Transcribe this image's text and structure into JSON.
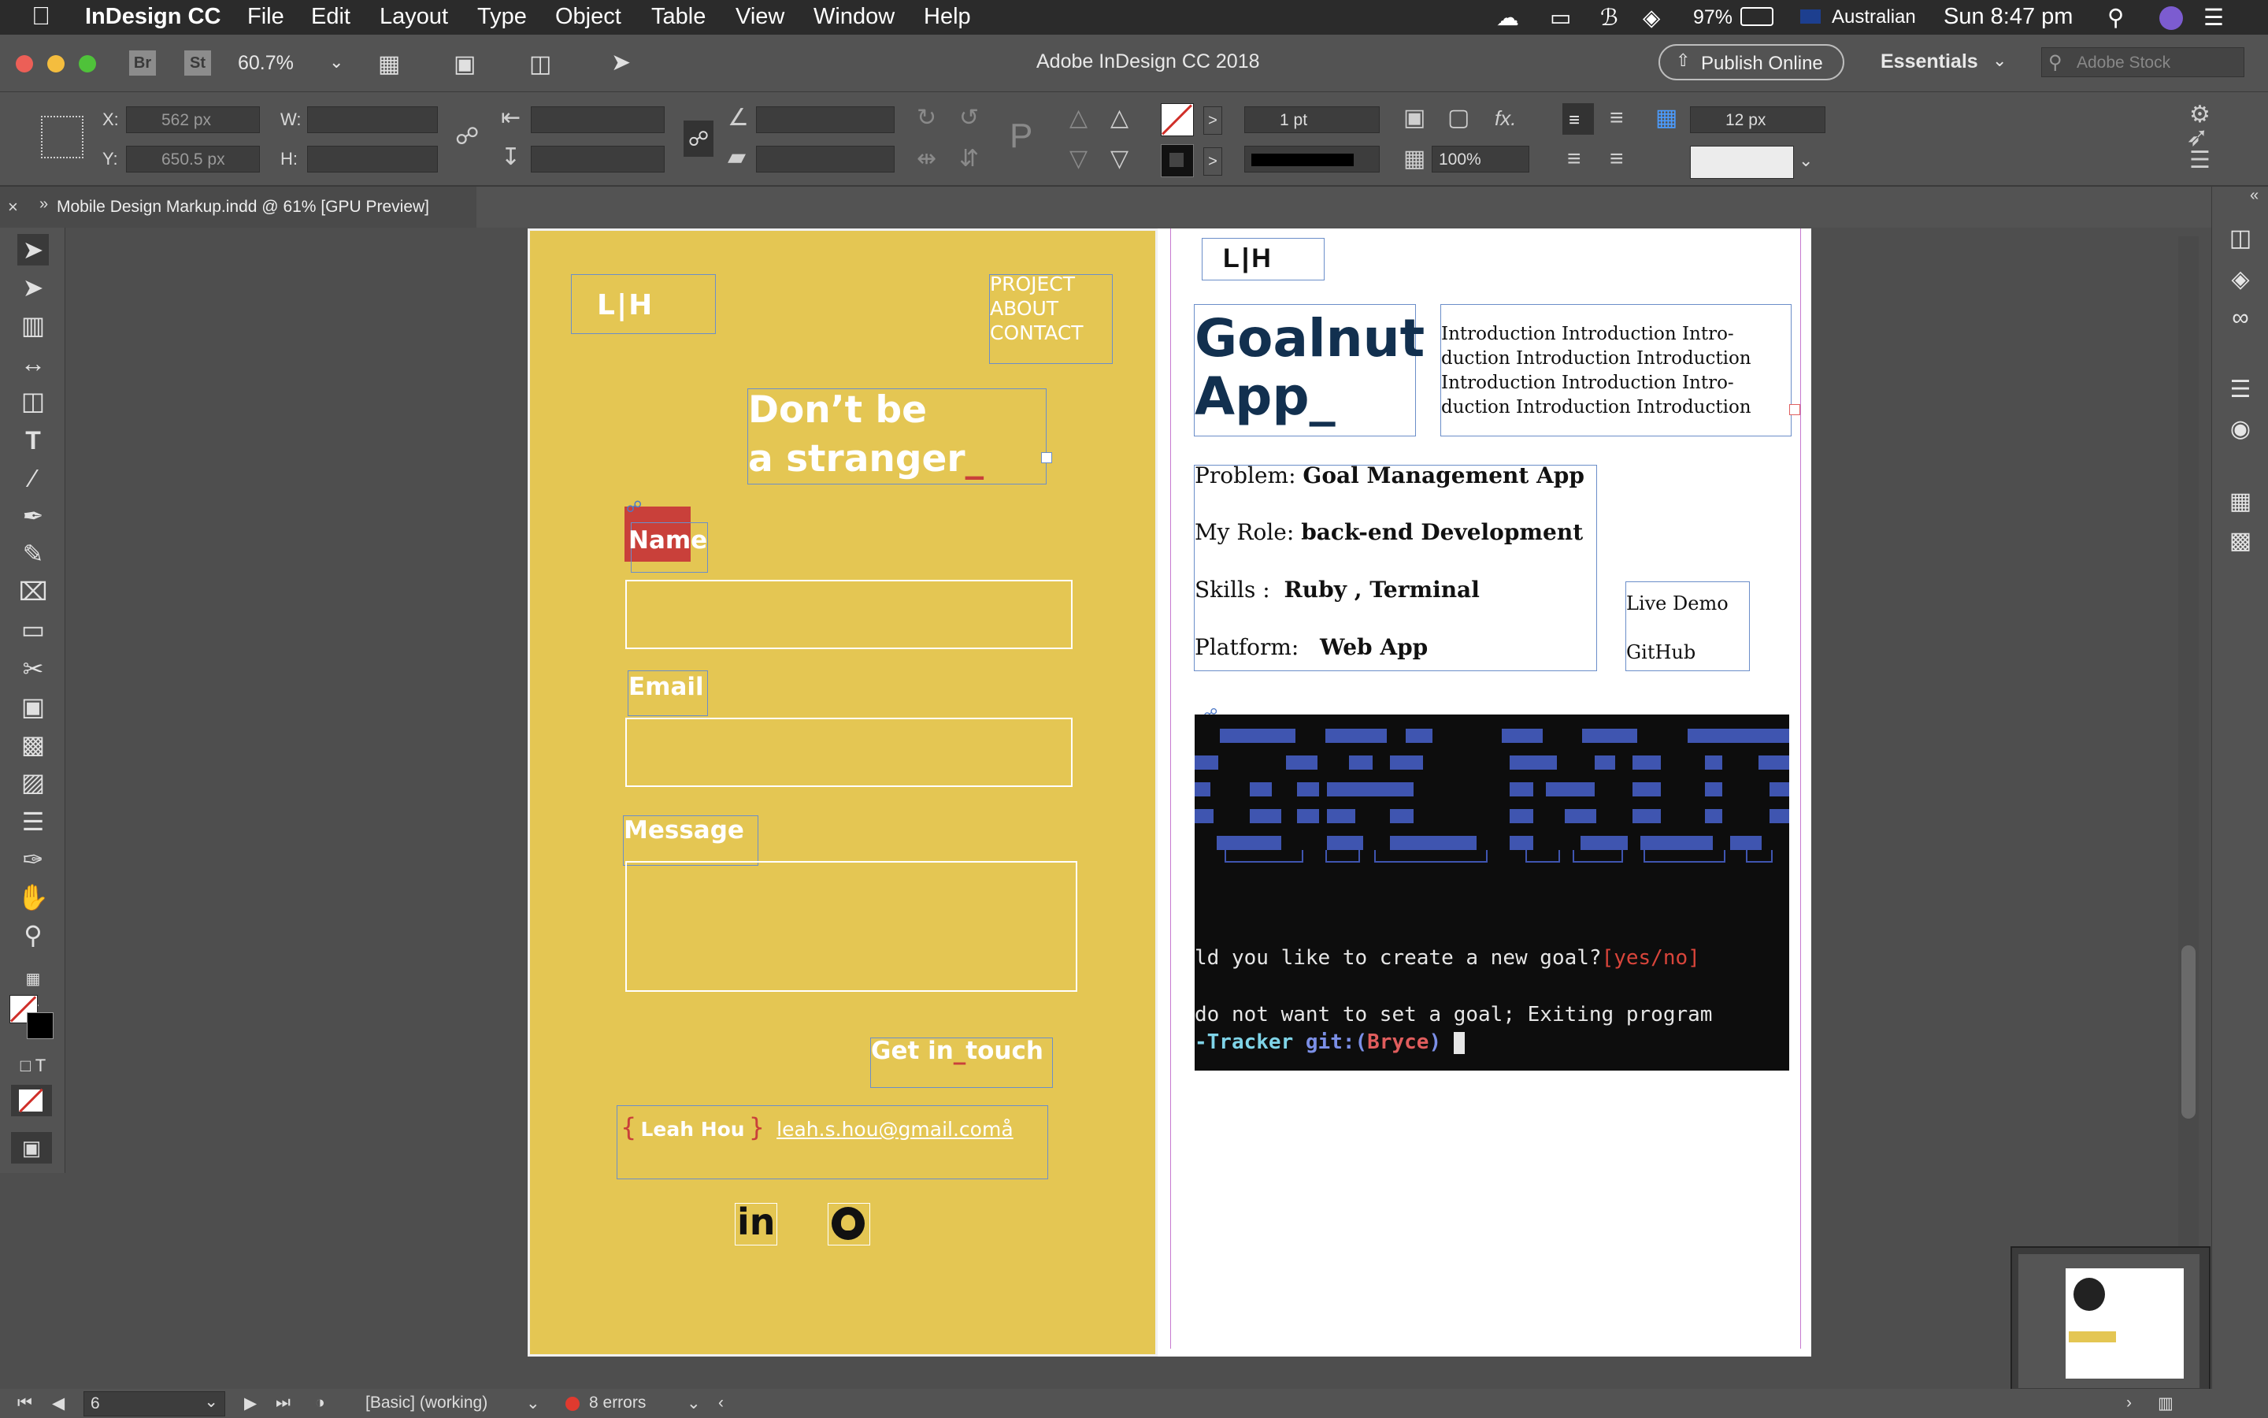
{
  "menubar": {
    "apple_icon": "apple-icon",
    "app_name": "InDesign CC",
    "menus": [
      "File",
      "Edit",
      "Layout",
      "Type",
      "Object",
      "Table",
      "View",
      "Window",
      "Help"
    ],
    "battery": "97%",
    "input_source": "Australian",
    "clock": "Sun 8:47 pm"
  },
  "appbar": {
    "bridge": "Br",
    "stock": "St",
    "zoom": "60.7%",
    "title": "Adobe InDesign CC 2018",
    "publish": "Publish Online",
    "workspace": "Essentials",
    "search_placeholder": "Adobe Stock"
  },
  "control": {
    "x_label": "X:",
    "x_value": "562 px",
    "y_label": "Y:",
    "y_value": "650.5 px",
    "w_label": "W:",
    "h_label": "H:",
    "stroke_weight": "1 pt",
    "opacity": "100%",
    "gap": "12 px",
    "fx": "fx."
  },
  "doc_tab": "Mobile Design Markup.indd @ 61% [GPU Preview]",
  "left_page": {
    "logo": "L|H",
    "nav": [
      "PROJECT",
      "ABOUT",
      "CONTACT"
    ],
    "heading_line1": "Don’t be",
    "heading_line2": "a stranger",
    "heading_cursor": "_",
    "name_label": "Name",
    "email_label": "Email",
    "message_label": "Message",
    "cta_prefix": "Get in",
    "cta_cursor": "_",
    "cta_suffix": "touch",
    "brace_open": "{",
    "signature": "Leah Hou",
    "brace_close": "}",
    "email_link": "leah.s.hou@gmail.comå",
    "linkedin": "in",
    "github_icon": "github-icon"
  },
  "right_page": {
    "logo": "L|H",
    "title_line1": "Goalnut",
    "title_line2": "App_",
    "intro": [
      "Introduction Introduction Intro-",
      "duction Introduction Introduction",
      "Introduction Introduction Intro-",
      "duction Introduction Introduction"
    ],
    "details": [
      {
        "label": "Problem:",
        "value": "Goal Management App"
      },
      {
        "label": "My Role:",
        "value": "back-end Development"
      },
      {
        "label": "Skills :",
        "value": "Ruby , Terminal"
      },
      {
        "label": "Platform:",
        "value": "Web App"
      }
    ],
    "links": [
      "Live Demo",
      "GitHub"
    ],
    "terminal": {
      "prompt_line": "ld you like to create a new goal?",
      "prompt_options": "[yes/no]",
      "exit_line": "do not want to set a goal; Exiting program",
      "dir": "-Tracker",
      "git": "git:(",
      "branch": "Bryce",
      "git_close": ")"
    }
  },
  "status": {
    "page": "6",
    "style": "[Basic] (working)",
    "errors": "8 errors"
  },
  "colors": {
    "page_yellow": "#e4c653",
    "accent_red": "#c9403a",
    "title_navy": "#12304f",
    "terminal_blue": "#3f55b0"
  }
}
